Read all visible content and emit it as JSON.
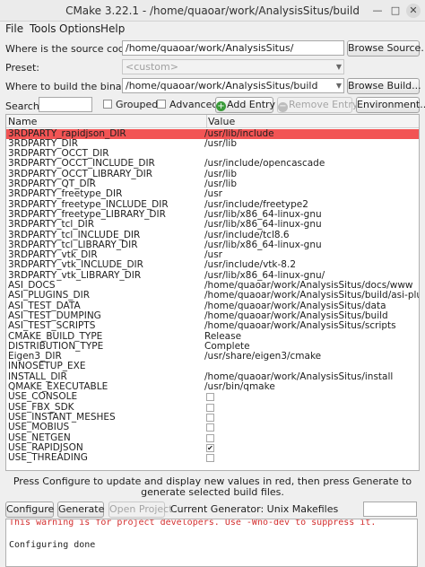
{
  "window": {
    "title": "CMake 3.22.1 - /home/quaoar/work/AnalysisSitus/build"
  },
  "menu": [
    "File",
    "Tools",
    "Options",
    "Help"
  ],
  "source": {
    "label": "Where is the source code:",
    "value": "/home/quaoar/work/AnalysisSitus/",
    "button": "Browse Source..."
  },
  "preset": {
    "label": "Preset:",
    "value": "<custom>"
  },
  "build": {
    "label": "Where to build the binaries:",
    "value": "/home/quaoar/work/AnalysisSitus/build",
    "button": "Browse Build..."
  },
  "toolbar": {
    "search_label": "Search:",
    "search_value": "",
    "grouped_label": "Grouped",
    "advanced_label": "Advanced",
    "add_entry": "Add Entry",
    "remove_entry": "Remove Entry",
    "environment": "Environment..."
  },
  "table": {
    "headers": [
      "Name",
      "Value"
    ],
    "rows": [
      {
        "name": "3RDPARTY_rapidjson_DIR",
        "value": "/usr/lib/include",
        "highlight": true
      },
      {
        "name": "3RDPARTY_DIR",
        "value": "/usr/lib"
      },
      {
        "name": "3RDPARTY_OCCT_DIR",
        "value": ""
      },
      {
        "name": "3RDPARTY_OCCT_INCLUDE_DIR",
        "value": "/usr/include/opencascade"
      },
      {
        "name": "3RDPARTY_OCCT_LIBRARY_DIR",
        "value": "/usr/lib"
      },
      {
        "name": "3RDPARTY_QT_DIR",
        "value": "/usr/lib"
      },
      {
        "name": "3RDPARTY_freetype_DIR",
        "value": "/usr"
      },
      {
        "name": "3RDPARTY_freetype_INCLUDE_DIR",
        "value": "/usr/include/freetype2"
      },
      {
        "name": "3RDPARTY_freetype_LIBRARY_DIR",
        "value": "/usr/lib/x86_64-linux-gnu"
      },
      {
        "name": "3RDPARTY_tcl_DIR",
        "value": "/usr/lib/x86_64-linux-gnu"
      },
      {
        "name": "3RDPARTY_tcl_INCLUDE_DIR",
        "value": "/usr/include/tcl8.6"
      },
      {
        "name": "3RDPARTY_tcl_LIBRARY_DIR",
        "value": "/usr/lib/x86_64-linux-gnu"
      },
      {
        "name": "3RDPARTY_vtk_DIR",
        "value": "/usr"
      },
      {
        "name": "3RDPARTY_vtk_INCLUDE_DIR",
        "value": "/usr/include/vtk-8.2"
      },
      {
        "name": "3RDPARTY_vtk_LIBRARY_DIR",
        "value": "/usr/lib/x86_64-linux-gnu/"
      },
      {
        "name": "ASI_DOCS",
        "value": "/home/quaoar/work/AnalysisSitus/docs/www"
      },
      {
        "name": "ASI_PLUGINS_DIR",
        "value": "/home/quaoar/work/AnalysisSitus/build/asi-plugins"
      },
      {
        "name": "ASI_TEST_DATA",
        "value": "/home/quaoar/work/AnalysisSitus/data"
      },
      {
        "name": "ASI_TEST_DUMPING",
        "value": "/home/quaoar/work/AnalysisSitus/build"
      },
      {
        "name": "ASI_TEST_SCRIPTS",
        "value": "/home/quaoar/work/AnalysisSitus/scripts"
      },
      {
        "name": "CMAKE_BUILD_TYPE",
        "value": "Release"
      },
      {
        "name": "DISTRIBUTION_TYPE",
        "value": "Complete"
      },
      {
        "name": "Eigen3_DIR",
        "value": "/usr/share/eigen3/cmake"
      },
      {
        "name": "INNOSETUP_EXE",
        "value": ""
      },
      {
        "name": "INSTALL_DIR",
        "value": "/home/quaoar/work/AnalysisSitus/install"
      },
      {
        "name": "QMAKE_EXECUTABLE",
        "value": "/usr/bin/qmake"
      },
      {
        "name": "USE_CONSOLE",
        "checkbox": true,
        "checked": false
      },
      {
        "name": "USE_FBX_SDK",
        "checkbox": true,
        "checked": false
      },
      {
        "name": "USE_INSTANT_MESHES",
        "checkbox": true,
        "checked": false
      },
      {
        "name": "USE_MOBIUS",
        "checkbox": true,
        "checked": false
      },
      {
        "name": "USE_NETGEN",
        "checkbox": true,
        "checked": false
      },
      {
        "name": "USE_RAPIDJSON",
        "checkbox": true,
        "checked": true
      },
      {
        "name": "USE_THREADING",
        "checkbox": true,
        "checked": false
      }
    ]
  },
  "info_text": "Press Configure to update and display new values in red, then press Generate to generate selected build files.",
  "actions": {
    "configure": "Configure",
    "generate": "Generate",
    "open_project": "Open Project",
    "generator_label": "Current Generator: Unix Makefiles"
  },
  "output": {
    "warning_line": "This warning is for project developers.  Use -Wno-dev to suppress it.",
    "done_line": "Configuring done"
  },
  "colors": {
    "highlight_row": "#f25454",
    "warning_text": "#d32f2f"
  },
  "icons": {
    "add": "plus-circle-icon",
    "remove": "minus-circle-icon",
    "minimize": "minimize-icon",
    "maximize": "maximize-icon",
    "close": "close-icon"
  }
}
